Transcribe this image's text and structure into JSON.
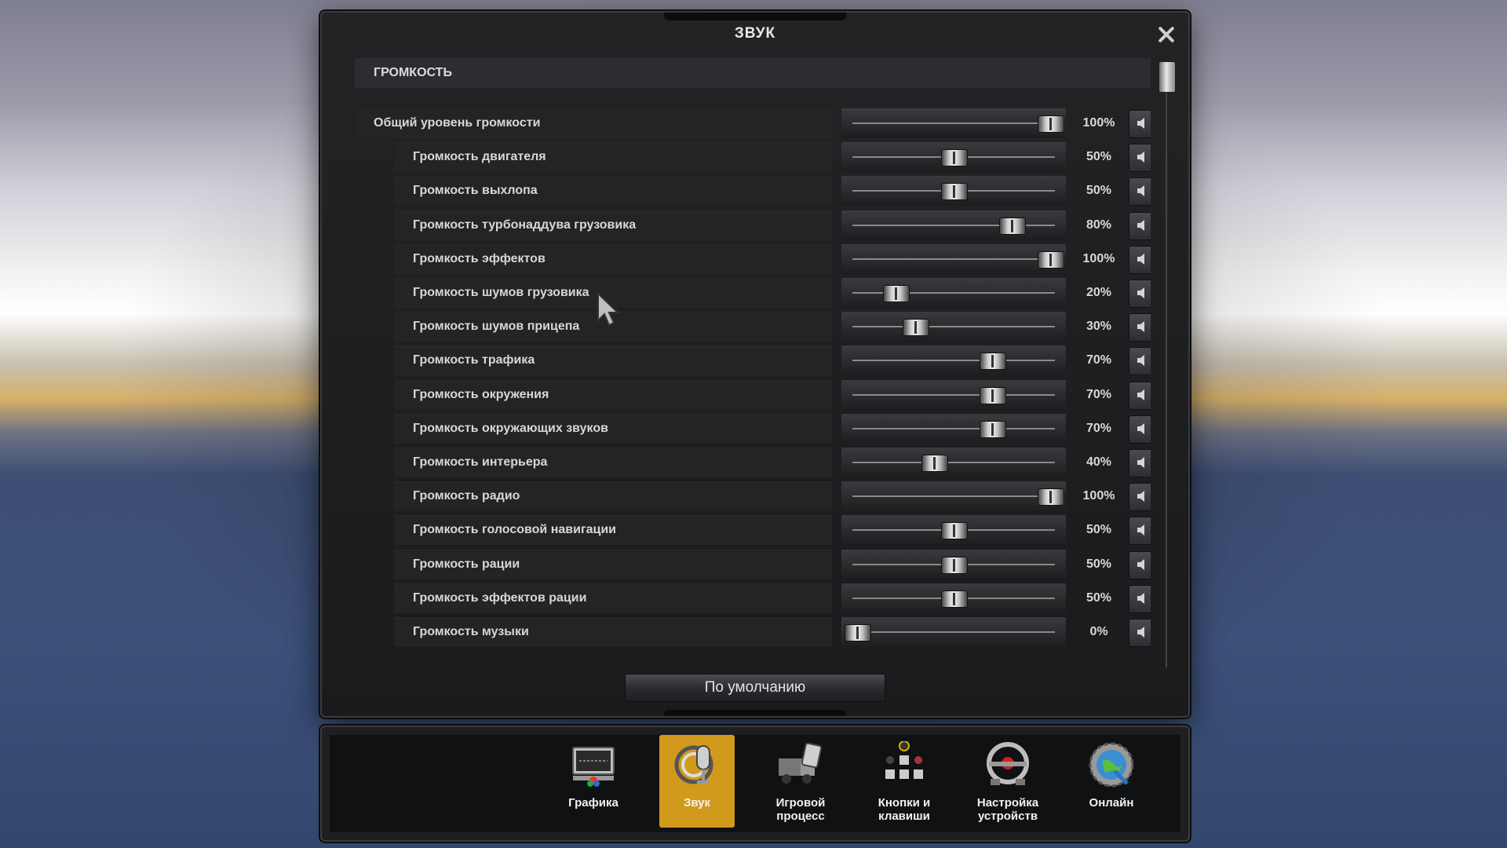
{
  "dialog": {
    "title": "ЗВУК",
    "section": "ГРОМКОСТЬ",
    "default_button": "По умолчанию"
  },
  "volume_rows": [
    {
      "label": "Общий уровень громкости",
      "value": "100%",
      "level": 1.0,
      "master": true
    },
    {
      "label": "Громкость двигателя",
      "value": "50%",
      "level": 0.5
    },
    {
      "label": "Громкость выхлопа",
      "value": "50%",
      "level": 0.5
    },
    {
      "label": "Громкость турбонаддува грузовика",
      "value": "80%",
      "level": 0.8
    },
    {
      "label": "Громкость эффектов",
      "value": "100%",
      "level": 1.0
    },
    {
      "label": "Громкость шумов грузовика",
      "value": "20%",
      "level": 0.2
    },
    {
      "label": "Громкость шумов прицепа",
      "value": "30%",
      "level": 0.3
    },
    {
      "label": "Громкость трафика",
      "value": "70%",
      "level": 0.7
    },
    {
      "label": "Громкость окружения",
      "value": "70%",
      "level": 0.7
    },
    {
      "label": "Громкость окружающих звуков",
      "value": "70%",
      "level": 0.7
    },
    {
      "label": "Громкость интерьера",
      "value": "40%",
      "level": 0.4
    },
    {
      "label": "Громкость радио",
      "value": "100%",
      "level": 1.0
    },
    {
      "label": "Громкость голосовой навигации",
      "value": "50%",
      "level": 0.5
    },
    {
      "label": "Громкость рации",
      "value": "50%",
      "level": 0.5
    },
    {
      "label": "Громкость эффектов рации",
      "value": "50%",
      "level": 0.5
    },
    {
      "label": "Громкость музыки",
      "value": "0%",
      "level": 0.0
    }
  ],
  "nav": [
    {
      "label": "Графика",
      "icon": "monitor-icon",
      "active": false
    },
    {
      "label": "Звук",
      "icon": "microphone-icon",
      "active": true
    },
    {
      "label": "Игровой процесс",
      "icon": "truck-icon",
      "active": false
    },
    {
      "label": "Кнопки и клавиши",
      "icon": "gamepad-buttons-icon",
      "active": false
    },
    {
      "label": "Настройка устройств",
      "icon": "steering-wheel-icon",
      "active": false
    },
    {
      "label": "Онлайн",
      "icon": "globe-gear-icon",
      "active": false
    }
  ],
  "colors": {
    "active_tab": "#d29a1c",
    "panel": "#1a1b1d"
  }
}
